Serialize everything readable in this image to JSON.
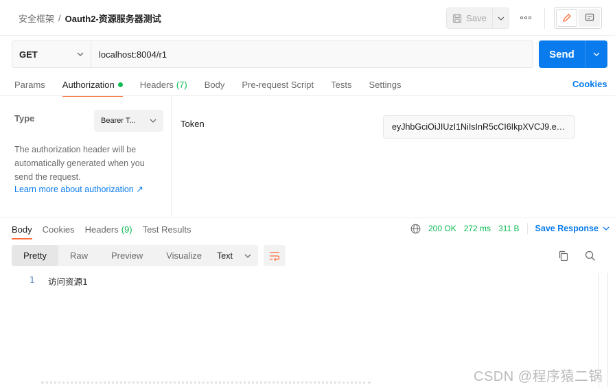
{
  "breadcrumb": {
    "parent": "安全框架",
    "separator": "/",
    "current": "Oauth2-资源服务器测试"
  },
  "toolbar": {
    "save_label": "Save"
  },
  "request": {
    "method": "GET",
    "url": "localhost:8004/r1",
    "send_label": "Send"
  },
  "request_tabs": [
    {
      "label": "Params"
    },
    {
      "label": "Authorization",
      "active": true
    },
    {
      "label": "Headers",
      "count": "(7)"
    },
    {
      "label": "Body"
    },
    {
      "label": "Pre-request Script"
    },
    {
      "label": "Tests"
    },
    {
      "label": "Settings"
    }
  ],
  "cookies_link": "Cookies",
  "auth": {
    "type_label": "Type",
    "type_value": "Bearer T...",
    "description": "The authorization header will be automatically generated when you send the request.",
    "learn_more": "Learn more about authorization ↗",
    "token_label": "Token",
    "token_value": "eyJhbGciOiJIUzI1NiIsInR5cCI6IkpXVCJ9.eyJ..."
  },
  "response_tabs": [
    {
      "label": "Body",
      "active": true
    },
    {
      "label": "Cookies"
    },
    {
      "label": "Headers",
      "count": "(9)"
    },
    {
      "label": "Test Results"
    }
  ],
  "response_status": {
    "code": "200 OK",
    "time": "272 ms",
    "size": "311 B",
    "save_response": "Save Response"
  },
  "view_modes": [
    {
      "label": "Pretty",
      "active": true
    },
    {
      "label": "Raw"
    },
    {
      "label": "Preview"
    },
    {
      "label": "Visualize"
    }
  ],
  "format": "Text",
  "response_body": {
    "line_number": "1",
    "content": "访问资源1"
  },
  "watermark": "CSDN @程序猿二锅头",
  "colors": {
    "accent": "#ff6c37",
    "primary": "#097bed",
    "success": "#0cbb52"
  }
}
